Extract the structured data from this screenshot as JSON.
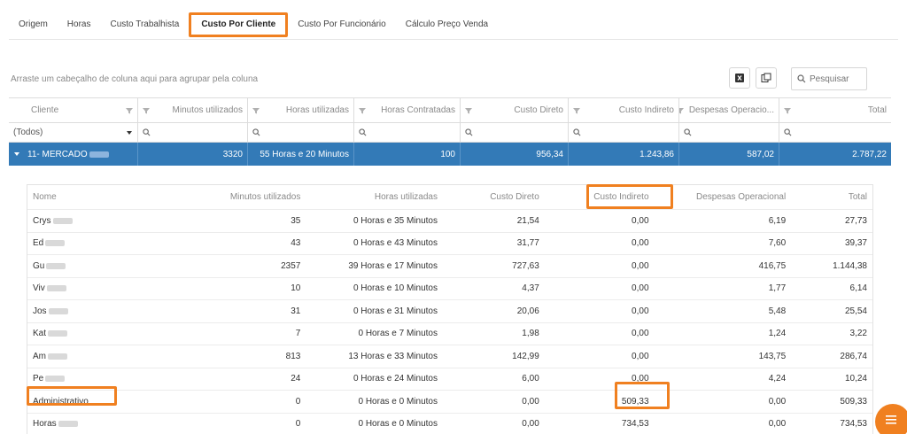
{
  "tabs": [
    "Origem",
    "Horas",
    "Custo Trabalhista",
    "Custo Por Cliente",
    "Custo Por Funcionário",
    "Cálculo Preço Venda"
  ],
  "group_hint": "Arraste um cabeçalho de coluna aqui para agrupar pela coluna",
  "search": {
    "placeholder": "Pesquisar"
  },
  "columns": [
    "Cliente",
    "Minutos utilizados",
    "Horas utilizadas",
    "Horas Contratadas",
    "Custo Direto",
    "Custo Indireto",
    "Despesas Operacio...",
    "Total"
  ],
  "filter_first": "(Todos)",
  "group_row": {
    "cliente": "11- MERCADO",
    "minutos": "3320",
    "horas": "55 Horas e 20 Minutos",
    "contratadas": "100",
    "direto": "956,34",
    "indireto": "1.243,86",
    "despesas": "587,02",
    "total": "2.787,22"
  },
  "detail_headers": [
    "Nome",
    "Minutos utilizados",
    "Horas utilizadas",
    "Custo Direto",
    "Custo Indireto",
    "Despesas Operacional",
    "Total"
  ],
  "detail_rows": [
    [
      "Crys",
      "35",
      "0 Horas e 35 Minutos",
      "21,54",
      "0,00",
      "6,19",
      "27,73"
    ],
    [
      "Ed",
      "43",
      "0 Horas e 43 Minutos",
      "31,77",
      "0,00",
      "7,60",
      "39,37"
    ],
    [
      "Gu",
      "2357",
      "39 Horas e 17 Minutos",
      "727,63",
      "0,00",
      "416,75",
      "1.144,38"
    ],
    [
      "Viv",
      "10",
      "0 Horas e 10 Minutos",
      "4,37",
      "0,00",
      "1,77",
      "6,14"
    ],
    [
      "Jos",
      "31",
      "0 Horas e 31 Minutos",
      "20,06",
      "0,00",
      "5,48",
      "25,54"
    ],
    [
      "Kat",
      "7",
      "0 Horas e 7 Minutos",
      "1,98",
      "0,00",
      "1,24",
      "3,22"
    ],
    [
      "Am",
      "813",
      "13 Horas e 33 Minutos",
      "142,99",
      "0,00",
      "143,75",
      "286,74"
    ],
    [
      "Pe",
      "24",
      "0 Horas e 24 Minutos",
      "6,00",
      "0,00",
      "4,24",
      "10,24"
    ],
    [
      "Administrativo",
      "0",
      "0 Horas e 0 Minutos",
      "0,00",
      "509,33",
      "0,00",
      "509,33"
    ],
    [
      "Horas",
      "0",
      "0 Horas e 0 Minutos",
      "0,00",
      "734,53",
      "0,00",
      "734,53"
    ]
  ],
  "colors": {
    "accent": "#f08020",
    "group_row": "#337ab7"
  }
}
